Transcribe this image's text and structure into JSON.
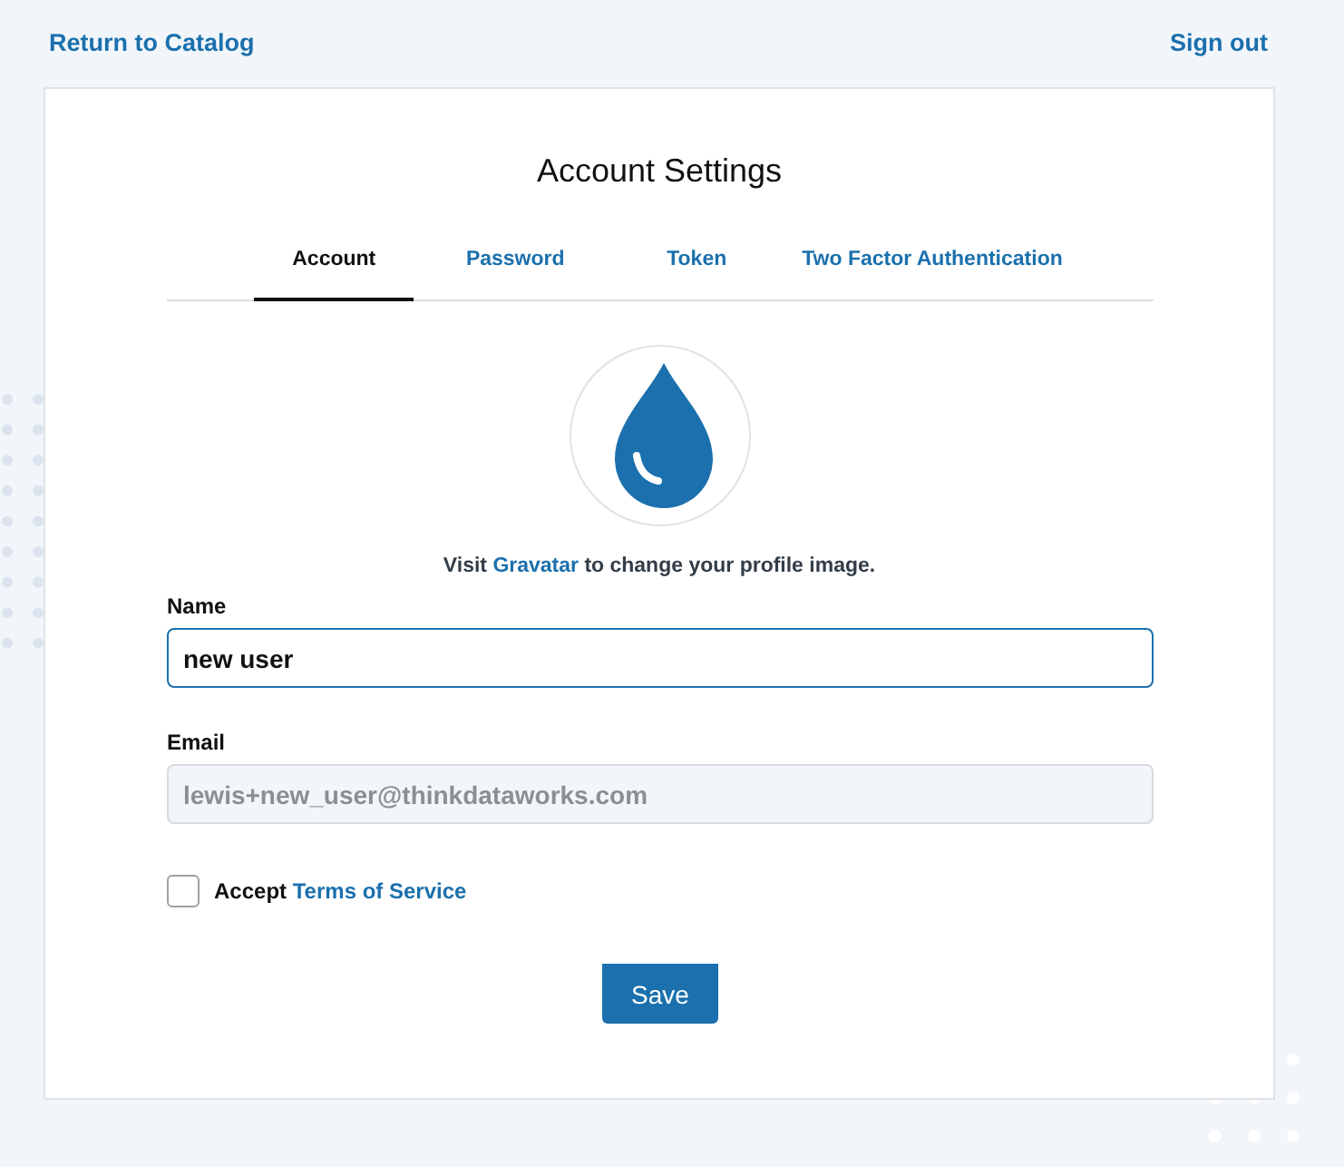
{
  "header": {
    "back_link": "Return to Catalog",
    "sign_out_link": "Sign out"
  },
  "card": {
    "title": "Account Settings",
    "tabs": [
      {
        "label": "Account",
        "selected": true
      },
      {
        "label": "Password",
        "selected": false
      },
      {
        "label": "Token",
        "selected": false
      },
      {
        "label": "Two Factor Authentication",
        "selected": false
      }
    ],
    "avatar_hint": {
      "before": "Visit ",
      "link": "Gravatar",
      "after": " to change your profile image."
    },
    "fields": [
      {
        "label": "Name",
        "value": "new user",
        "focused": true,
        "disabled": false
      },
      {
        "label": "Email",
        "value": "lewis+new_user@thinkdataworks.com",
        "focused": false,
        "disabled": true
      }
    ],
    "terms": {
      "checked": false,
      "text": "Accept",
      "link": "Terms of Service"
    },
    "save_button": "Save"
  }
}
